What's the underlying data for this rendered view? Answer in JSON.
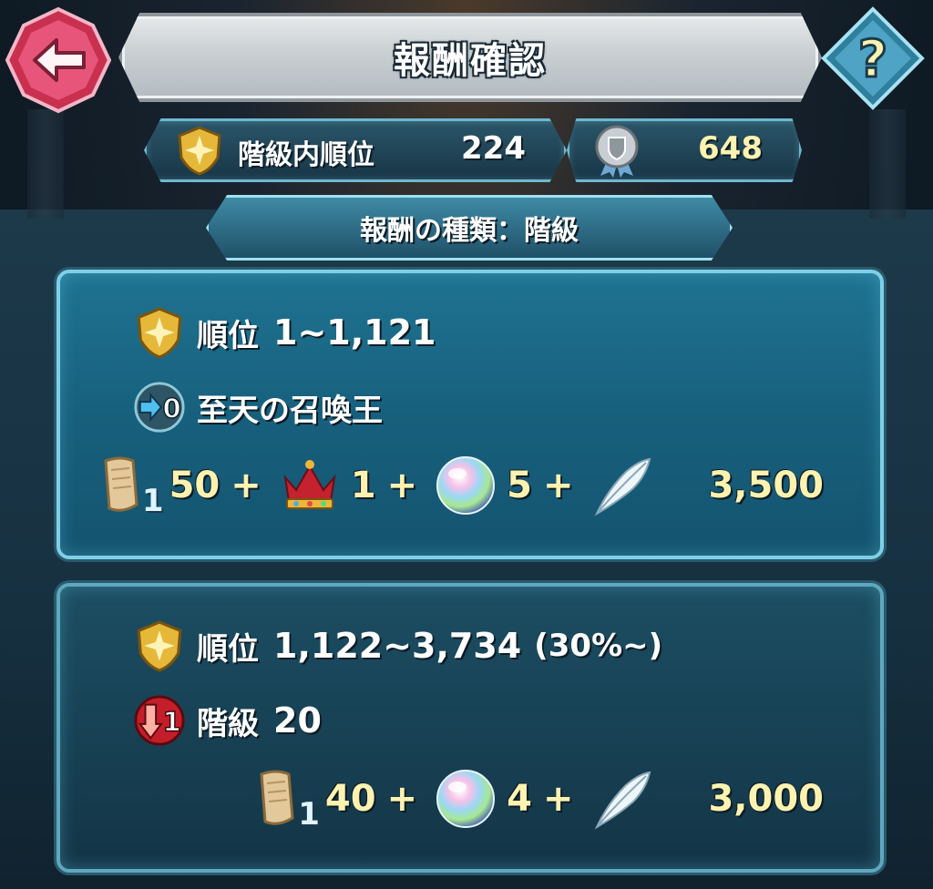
{
  "header": {
    "title": "報酬確認"
  },
  "stats": {
    "rank_label": "階級内順位",
    "rank_value": "224",
    "points_value": "648"
  },
  "reward_type": {
    "label": "報酬の種類：階級"
  },
  "panels": [
    {
      "rank_label": "順位",
      "rank_range": "1~1,121",
      "rank_note": "",
      "status_badge": "0",
      "status_text": "至天の召喚王",
      "rewards": [
        {
          "icon": "scroll-icon",
          "badge": "1",
          "amount": "50"
        },
        {
          "icon": "crown-icon",
          "amount": "1"
        },
        {
          "icon": "orb-icon",
          "amount": "5"
        },
        {
          "icon": "feather-icon",
          "amount": "3,500"
        }
      ]
    },
    {
      "rank_label": "順位",
      "rank_range": "1,122~3,734",
      "rank_note": "(30%~)",
      "status_badge": "1",
      "status_label": "階級",
      "status_text": "20",
      "rewards": [
        {
          "icon": "scroll-icon",
          "badge": "1",
          "amount": "40"
        },
        {
          "icon": "orb-icon",
          "amount": "4"
        },
        {
          "icon": "feather-icon",
          "amount": "3,000"
        }
      ]
    }
  ],
  "plus_sign": "+",
  "colors": {
    "accent_yellow": "#fdf2b0",
    "panel_border": "#7fd0e6",
    "back_button": "#e8557a",
    "help_button": "#4fa3c4"
  }
}
